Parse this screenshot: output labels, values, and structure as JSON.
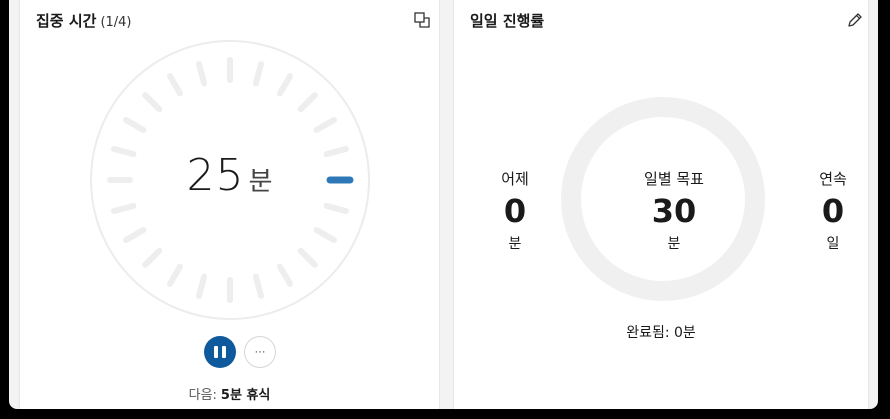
{
  "focus": {
    "title": "집중 시간",
    "session_count": "(1/4)",
    "timer_value": "25",
    "timer_unit": "분",
    "pause_icon": "pause-icon",
    "more_label": "···",
    "next_prefix": "다음:",
    "next_value": "5분 휴식",
    "popout_icon": "popout-icon",
    "progress_fraction": 0
  },
  "daily": {
    "title": "일일 진행률",
    "edit_icon": "pencil-icon",
    "yesterday": {
      "label": "어제",
      "value": "0",
      "unit": "분"
    },
    "goal": {
      "label": "일별 목표",
      "value": "30",
      "unit": "분"
    },
    "streak": {
      "label": "연속",
      "value": "0",
      "unit": "일"
    },
    "completed_text": "완료됨: 0분",
    "progress_fraction": 0
  },
  "colors": {
    "accent": "#0f5a9c",
    "current_tick": "#2f78b8",
    "tick": "#eeeeee",
    "ring": "#f0f0f0"
  }
}
